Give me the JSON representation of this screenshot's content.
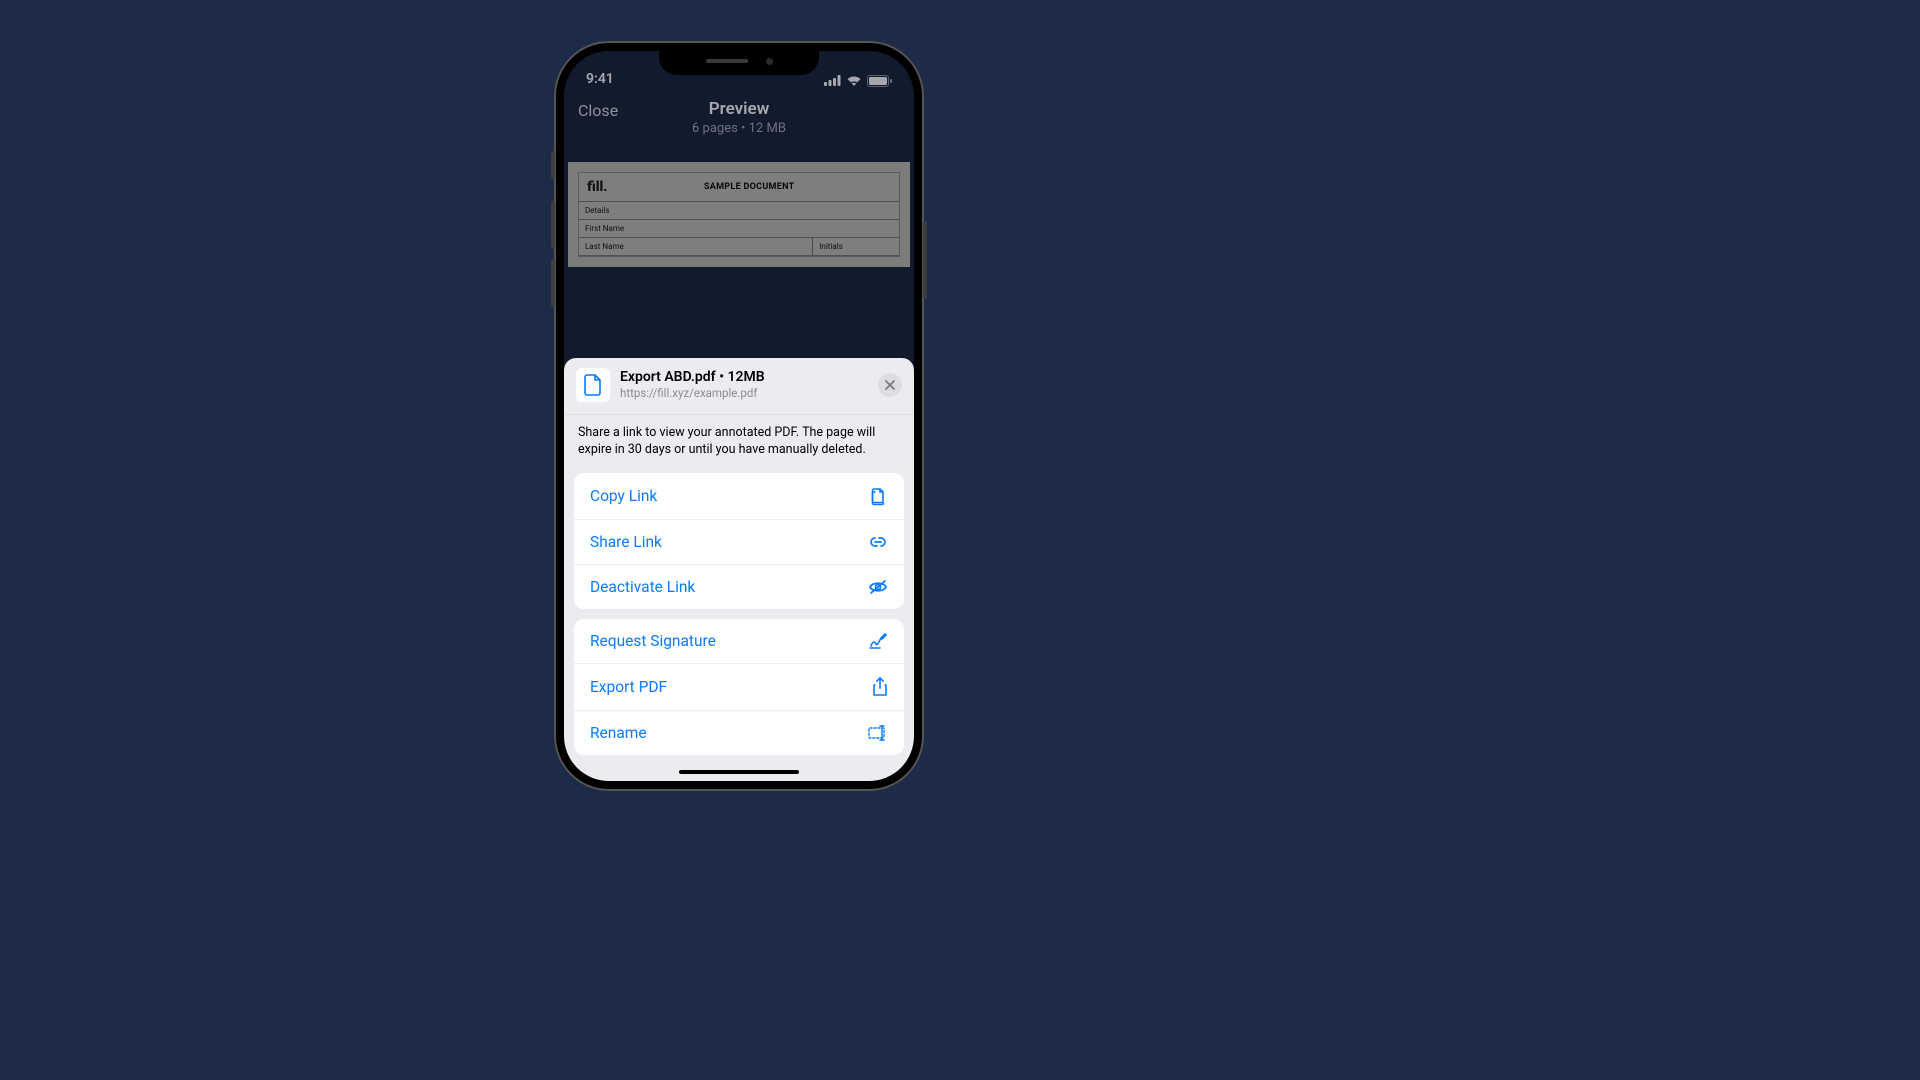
{
  "statusbar": {
    "time": "9:41"
  },
  "nav": {
    "close": "Close",
    "title": "Preview",
    "subtitle": "6 pages • 12 MB"
  },
  "document": {
    "logo": "fill.",
    "title": "SAMPLE DOCUMENT",
    "rows": {
      "details": "Details",
      "first_name": "First Name",
      "last_name": "Last Name",
      "initials": "Initials"
    }
  },
  "sheet": {
    "header": {
      "title": "Export ABD.pdf • 12MB",
      "url": "https://fill.xyz/example.pdf"
    },
    "description": "Share a link to view your annotated PDF. The page will expire in 30 days or until you have manually deleted.",
    "actions": {
      "copy_link": "Copy Link",
      "share_link": "Share Link",
      "deactivate_link": "Deactivate Link",
      "request_signature": "Request Signature",
      "export_pdf": "Export PDF",
      "rename": "Rename"
    }
  }
}
